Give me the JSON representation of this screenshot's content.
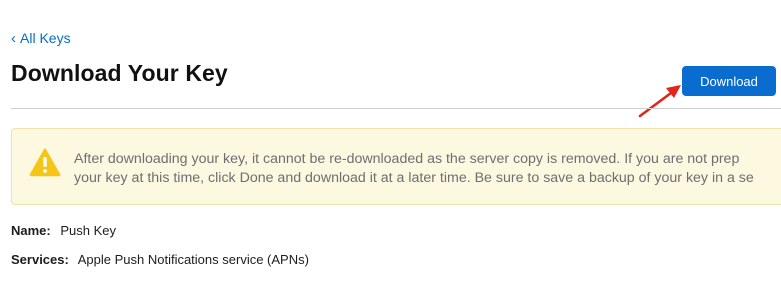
{
  "nav": {
    "back_label": "All Keys",
    "back_chevron": "‹"
  },
  "header": {
    "title": "Download Your Key",
    "download_label": "Download"
  },
  "annotation": {
    "arrow_color": "#e3241b"
  },
  "warning": {
    "icon": "warning-triangle-icon",
    "icon_color": "#f5c518",
    "line1": "After downloading your key, it cannot be re-downloaded as the server copy is removed. If you are not prep",
    "line2": "your key at this time, click Done and download it at a later time. Be sure to save a backup of your key in a se"
  },
  "details": {
    "name_label": "Name:",
    "name_value": "Push Key",
    "services_label": "Services:",
    "services_value": "Apple Push Notifications service (APNs)"
  },
  "colors": {
    "accent": "#0b6ccf",
    "link": "#0070c9",
    "warning_bg": "#fdf8e0"
  }
}
